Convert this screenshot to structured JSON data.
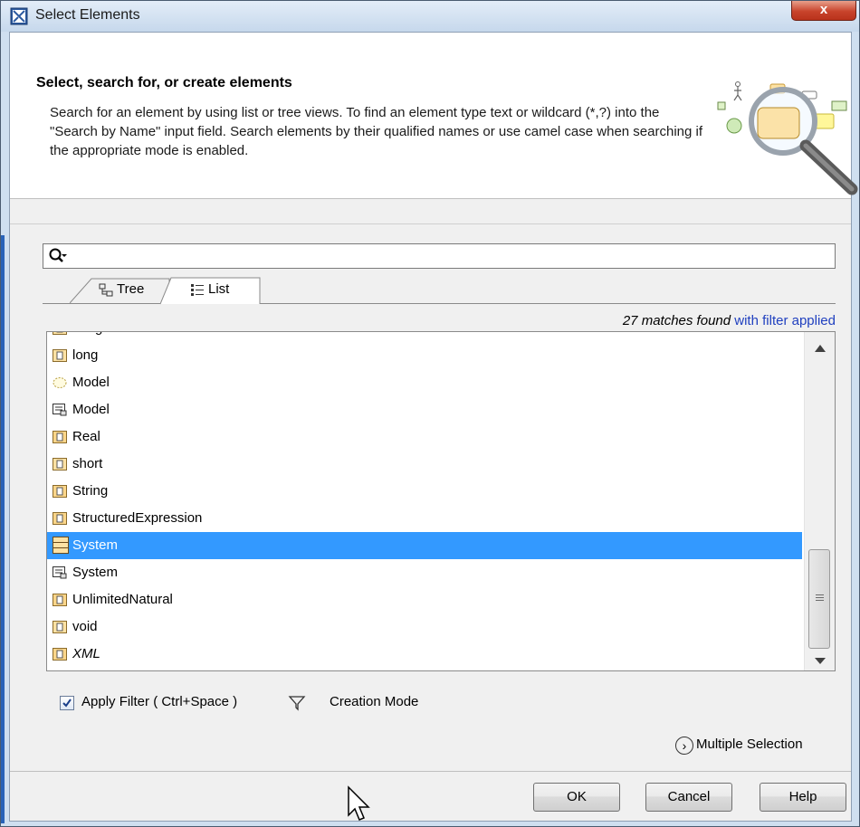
{
  "window": {
    "title": "Select Elements",
    "close_glyph": "x",
    "close_color": "#c8442c"
  },
  "header": {
    "title": "Select, search for, or create elements",
    "description": "Search for an element by using list or tree views. To find an element type text or wildcard (*,?) into the \"Search by Name\" input field. Search elements by their qualified names or use camel case when searching if the appropriate mode is enabled.",
    "graphic_icon": "search-magnifier-diagram-icon"
  },
  "search": {
    "value": "",
    "icon": "search-icon"
  },
  "tabs": [
    {
      "label": "Tree",
      "icon": "tree-icon",
      "active": false
    },
    {
      "label": "List",
      "icon": "list-icon",
      "active": true
    }
  ],
  "results": {
    "count_text": "27 matches found",
    "filter_text": "with filter applied",
    "filter_color": "#1f3fbf",
    "partial_top_item": "Integer"
  },
  "list_items": [
    {
      "label": "long",
      "icon": "datatype-icon"
    },
    {
      "label": "Model",
      "icon": "model-dashed-icon"
    },
    {
      "label": "Model",
      "icon": "model-package-icon"
    },
    {
      "label": "Real",
      "icon": "primitive-type-icon"
    },
    {
      "label": "short",
      "icon": "datatype-icon"
    },
    {
      "label": "String",
      "icon": "primitive-type-icon"
    },
    {
      "label": "StructuredExpression",
      "icon": "primitive-type-icon"
    },
    {
      "label": "System",
      "icon": "class-icon",
      "selected": true
    },
    {
      "label": "System",
      "icon": "model-package-icon"
    },
    {
      "label": "UnlimitedNatural",
      "icon": "primitive-type-icon"
    },
    {
      "label": "void",
      "icon": "datatype-icon"
    },
    {
      "label": "XML",
      "icon": "primitive-type-icon",
      "italic": true
    }
  ],
  "selection_color": "#3399ff",
  "options": {
    "apply_filter_label": "Apply Filter ( Ctrl+Space )",
    "apply_filter_checked": true,
    "filter_icon": "funnel-icon",
    "creation_mode_label": "Creation Mode",
    "multiple_selection_label": "Multiple Selection",
    "multiple_selection_icon": "chevron-circle-icon"
  },
  "buttons": {
    "ok": "OK",
    "cancel": "Cancel",
    "help": "Help"
  }
}
